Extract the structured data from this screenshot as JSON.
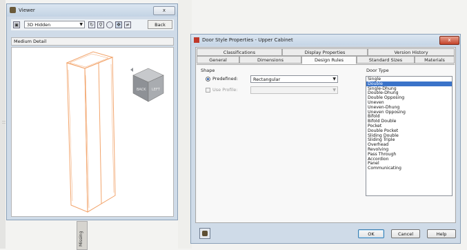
{
  "background": {
    "side_tab": "Missing"
  },
  "viewer": {
    "title": "Viewer",
    "close_label": "x",
    "view_mode": "3D Hidden",
    "back_label": "Back",
    "detail_level": "Medium Detail",
    "toolbar_icons": [
      "save-icon",
      "orbit-icon",
      "zoom-icon",
      "zoom-extents-icon",
      "pan-icon",
      "flip-icon"
    ],
    "viewcube_faces": [
      "BACK",
      "LEFT"
    ]
  },
  "dialog": {
    "title": "Door Style Properties - Upper Cabinet",
    "close_label": "x",
    "tabs_row1": [
      "Classifications",
      "Display Properties",
      "Version History"
    ],
    "tabs_row2": [
      "General",
      "Dimensions",
      "Design Rules",
      "Standard Sizes",
      "Materials"
    ],
    "active_tab": "Design Rules",
    "shape": {
      "group_label": "Shape",
      "predefined_label": "Predefined:",
      "predefined_value": "Rectangular",
      "use_profile_label": "Use Profile:",
      "use_profile_value": ""
    },
    "door_type": {
      "group_label": "Door Type",
      "items": [
        "Single",
        "Double",
        "Single-Dhung",
        "Double-Dhung",
        "Double Opposing",
        "Uneven",
        "Uneven-Dhung",
        "Uneven Opposing",
        "Bifold",
        "Bifold Double",
        "Pocket",
        "Double Pocket",
        "Sliding Double",
        "Sliding Triple",
        "Overhead",
        "Revolving",
        "Pass Through",
        "Accordion",
        "Panel",
        "Communicating"
      ],
      "selected": "Double"
    },
    "buttons": {
      "ok": "OK",
      "cancel": "Cancel",
      "help": "Help"
    }
  },
  "colors": {
    "accent_selection": "#3a73c9",
    "model_lines": "#f2a46b",
    "close_button": "#c4432a"
  }
}
